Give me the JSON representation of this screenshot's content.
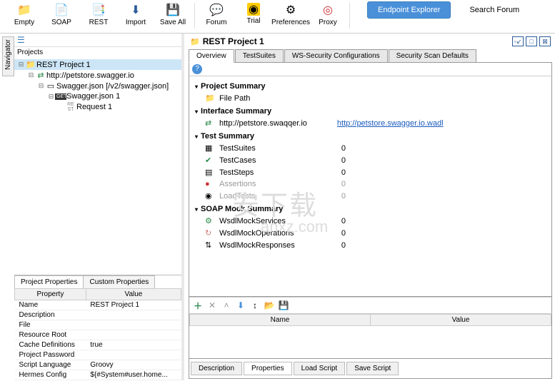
{
  "toolbar": {
    "empty": "Empty",
    "soap": "SOAP",
    "rest": "REST",
    "import": "Import",
    "saveall": "Save All",
    "forum": "Forum",
    "trial": "Trial",
    "preferences": "Preferences",
    "proxy": "Proxy",
    "endpoint_explorer": "Endpoint Explorer",
    "search_forum": "Search Forum"
  },
  "navigator_tab": "Navigator",
  "projects_label": "Projects",
  "tree": {
    "n0": "REST Project 1",
    "n1": "http://petstore.swagger.io",
    "n2": "Swagger.json [/v2/swagger.json]",
    "n3": "Swagger.json 1",
    "n4": "Request 1"
  },
  "prop_tabs": {
    "project": "Project Properties",
    "custom": "Custom Properties"
  },
  "prop_headers": {
    "property": "Property",
    "value": "Value"
  },
  "props": [
    {
      "k": "Name",
      "v": "REST Project 1"
    },
    {
      "k": "Description",
      "v": ""
    },
    {
      "k": "File",
      "v": ""
    },
    {
      "k": "Resource Root",
      "v": ""
    },
    {
      "k": "Cache Definitions",
      "v": "true"
    },
    {
      "k": "Project Password",
      "v": ""
    },
    {
      "k": "Script Language",
      "v": "Groovy"
    },
    {
      "k": "Hermes Config",
      "v": "${#System#user.home..."
    }
  ],
  "panel": {
    "title": "REST Project 1"
  },
  "detail_tabs": {
    "overview": "Overview",
    "testsuites": "TestSuites",
    "wssec": "WS-Security Configurations",
    "secscan": "Security Scan Defaults"
  },
  "sections": {
    "project_summary": "Project Summary",
    "file_path": "File Path",
    "interface_summary": "Interface Summary",
    "iface_host": "http://petstore.swaqqer.io",
    "iface_link": "http://petstore.swagger.io.wadl",
    "test_summary": "Test Summary",
    "testsuites": "TestSuites",
    "testcases": "TestCases",
    "teststeps": "TestSteps",
    "assertions": "Assertions",
    "loadtests": "LoadTests",
    "soap_mock": "SOAP Mock Summary",
    "mockservices": "WsdlMockServices",
    "mockops": "WsdlMockOperations",
    "mockresp": "WsdlMockResponses"
  },
  "chart_data": {
    "type": "table",
    "title": "Test Summary",
    "categories": [
      "TestSuites",
      "TestCases",
      "TestSteps",
      "Assertions",
      "LoadTests"
    ],
    "values": [
      0,
      0,
      0,
      0,
      0
    ]
  },
  "mock_counts": {
    "services": "0",
    "ops": "0",
    "resp": "0"
  },
  "grid_headers": {
    "name": "Name",
    "value": "Value"
  },
  "bottom_tabs": {
    "description": "Description",
    "properties": "Properties",
    "loadscript": "Load Script",
    "savescript": "Save Script"
  }
}
